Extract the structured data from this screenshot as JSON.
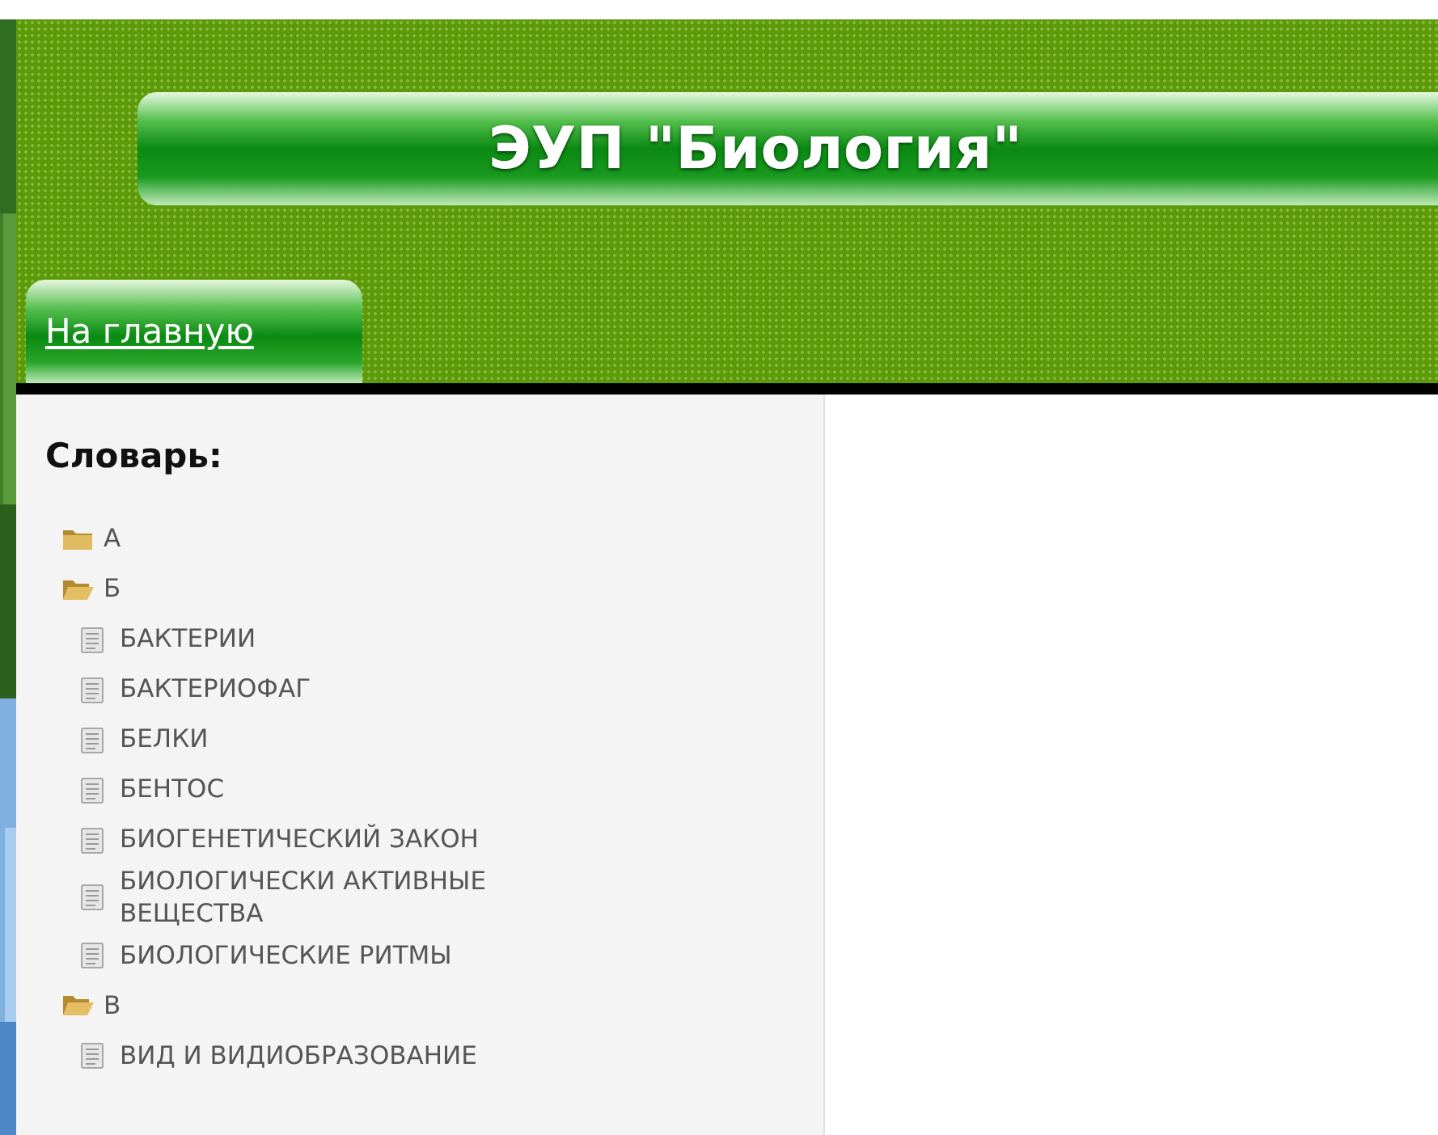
{
  "header": {
    "title": "ЭУП \"Биология\"",
    "home_link": "На главную"
  },
  "dictionary": {
    "title": "Словарь:",
    "letters": [
      {
        "label": "А",
        "expanded": false
      },
      {
        "label": "Б",
        "expanded": true,
        "children": [
          {
            "label": "БАКТЕРИИ"
          },
          {
            "label": "БАКТЕРИОФАГ"
          },
          {
            "label": "БЕЛКИ"
          },
          {
            "label": "БЕНТОС"
          },
          {
            "label": "БИОГЕНЕТИЧЕСКИЙ ЗАКОН"
          },
          {
            "label": "БИОЛОГИЧЕСКИ АКТИВНЫЕ ВЕЩЕСТВА"
          },
          {
            "label": "БИОЛОГИЧЕСКИЕ РИТМЫ"
          }
        ]
      },
      {
        "label": "В",
        "expanded": true,
        "children": [
          {
            "label": "ВИД И ВИДИОБРАЗОВАНИЕ"
          }
        ]
      }
    ]
  }
}
